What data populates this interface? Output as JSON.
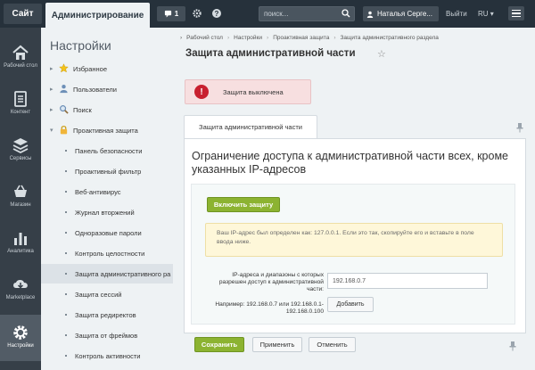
{
  "topbar": {
    "site_label": "Сайт",
    "admin_label": "Администрирование",
    "notifications_count": "1",
    "search_placeholder": "поиск...",
    "user_name": "Наталья Серге...",
    "logout_label": "Выйти",
    "language": "RU",
    "language_arrow": "▾"
  },
  "main_nav": [
    {
      "label": "Рабочий стол",
      "icon": "home-icon"
    },
    {
      "label": "Контент",
      "icon": "document-icon"
    },
    {
      "label": "Сервисы",
      "icon": "layers-icon"
    },
    {
      "label": "Магазин",
      "icon": "cart-icon"
    },
    {
      "label": "Аналитика",
      "icon": "bar-chart-icon"
    },
    {
      "label": "Marketplace",
      "icon": "cloud-download-icon"
    },
    {
      "label": "Настройки",
      "icon": "gear-icon"
    }
  ],
  "settings_nav": {
    "title": "Настройки",
    "items": [
      {
        "label": "Избранное",
        "arrow": "▸",
        "icon": "star-icon"
      },
      {
        "label": "Пользователи",
        "arrow": "▸",
        "icon": "user-icon"
      },
      {
        "label": "Поиск",
        "arrow": "▸",
        "icon": "search-icon"
      },
      {
        "label": "Проактивная защита",
        "arrow": "▾",
        "icon": "lock-icon"
      }
    ],
    "subitems": [
      "Панель безопасности",
      "Проактивный фильтр",
      "Веб-антивирус",
      "Журнал вторжений",
      "Одноразовые пароли",
      "Контроль целостности",
      "Защита административного ра",
      "Защита сессий",
      "Защита редиректов",
      "Защита от фреймов",
      "Контроль активности"
    ]
  },
  "breadcrumbs": {
    "items": [
      "Рабочий стол",
      "Настройки",
      "Проактивная защита",
      "Защита административного раздела"
    ],
    "separator": "›"
  },
  "page": {
    "title": "Защита административной части",
    "alert_icon_glyph": "!",
    "alert_message": "Защита выключена",
    "tab_label": "Защита административной части",
    "panel_heading": "Ограничение доступа к административной части всех, кроме указанных IP-адресов",
    "enable_button": "Включить защиту",
    "note_text": "Ваш IP-адрес был определен как: 127.0.0.1. Если это так, скопируйте его и вставьте в поле ввода ниже.",
    "ip_label": "IP-адреса и диапазоны с которых разрешен доступ к административной части:",
    "ip_example": "Например: 192.168.0.7 или 192.168.0.1-192.168.0.100",
    "ip_value": "192.168.0.7",
    "add_button": "Добавить",
    "save_button": "Сохранить",
    "apply_button": "Применить",
    "cancel_button": "Отменить"
  },
  "colors": {
    "topbar_bg": "#26313b",
    "sidebar_bg": "#363f48",
    "accent_green": "#8cb331",
    "alert_red": "#c8202f"
  }
}
